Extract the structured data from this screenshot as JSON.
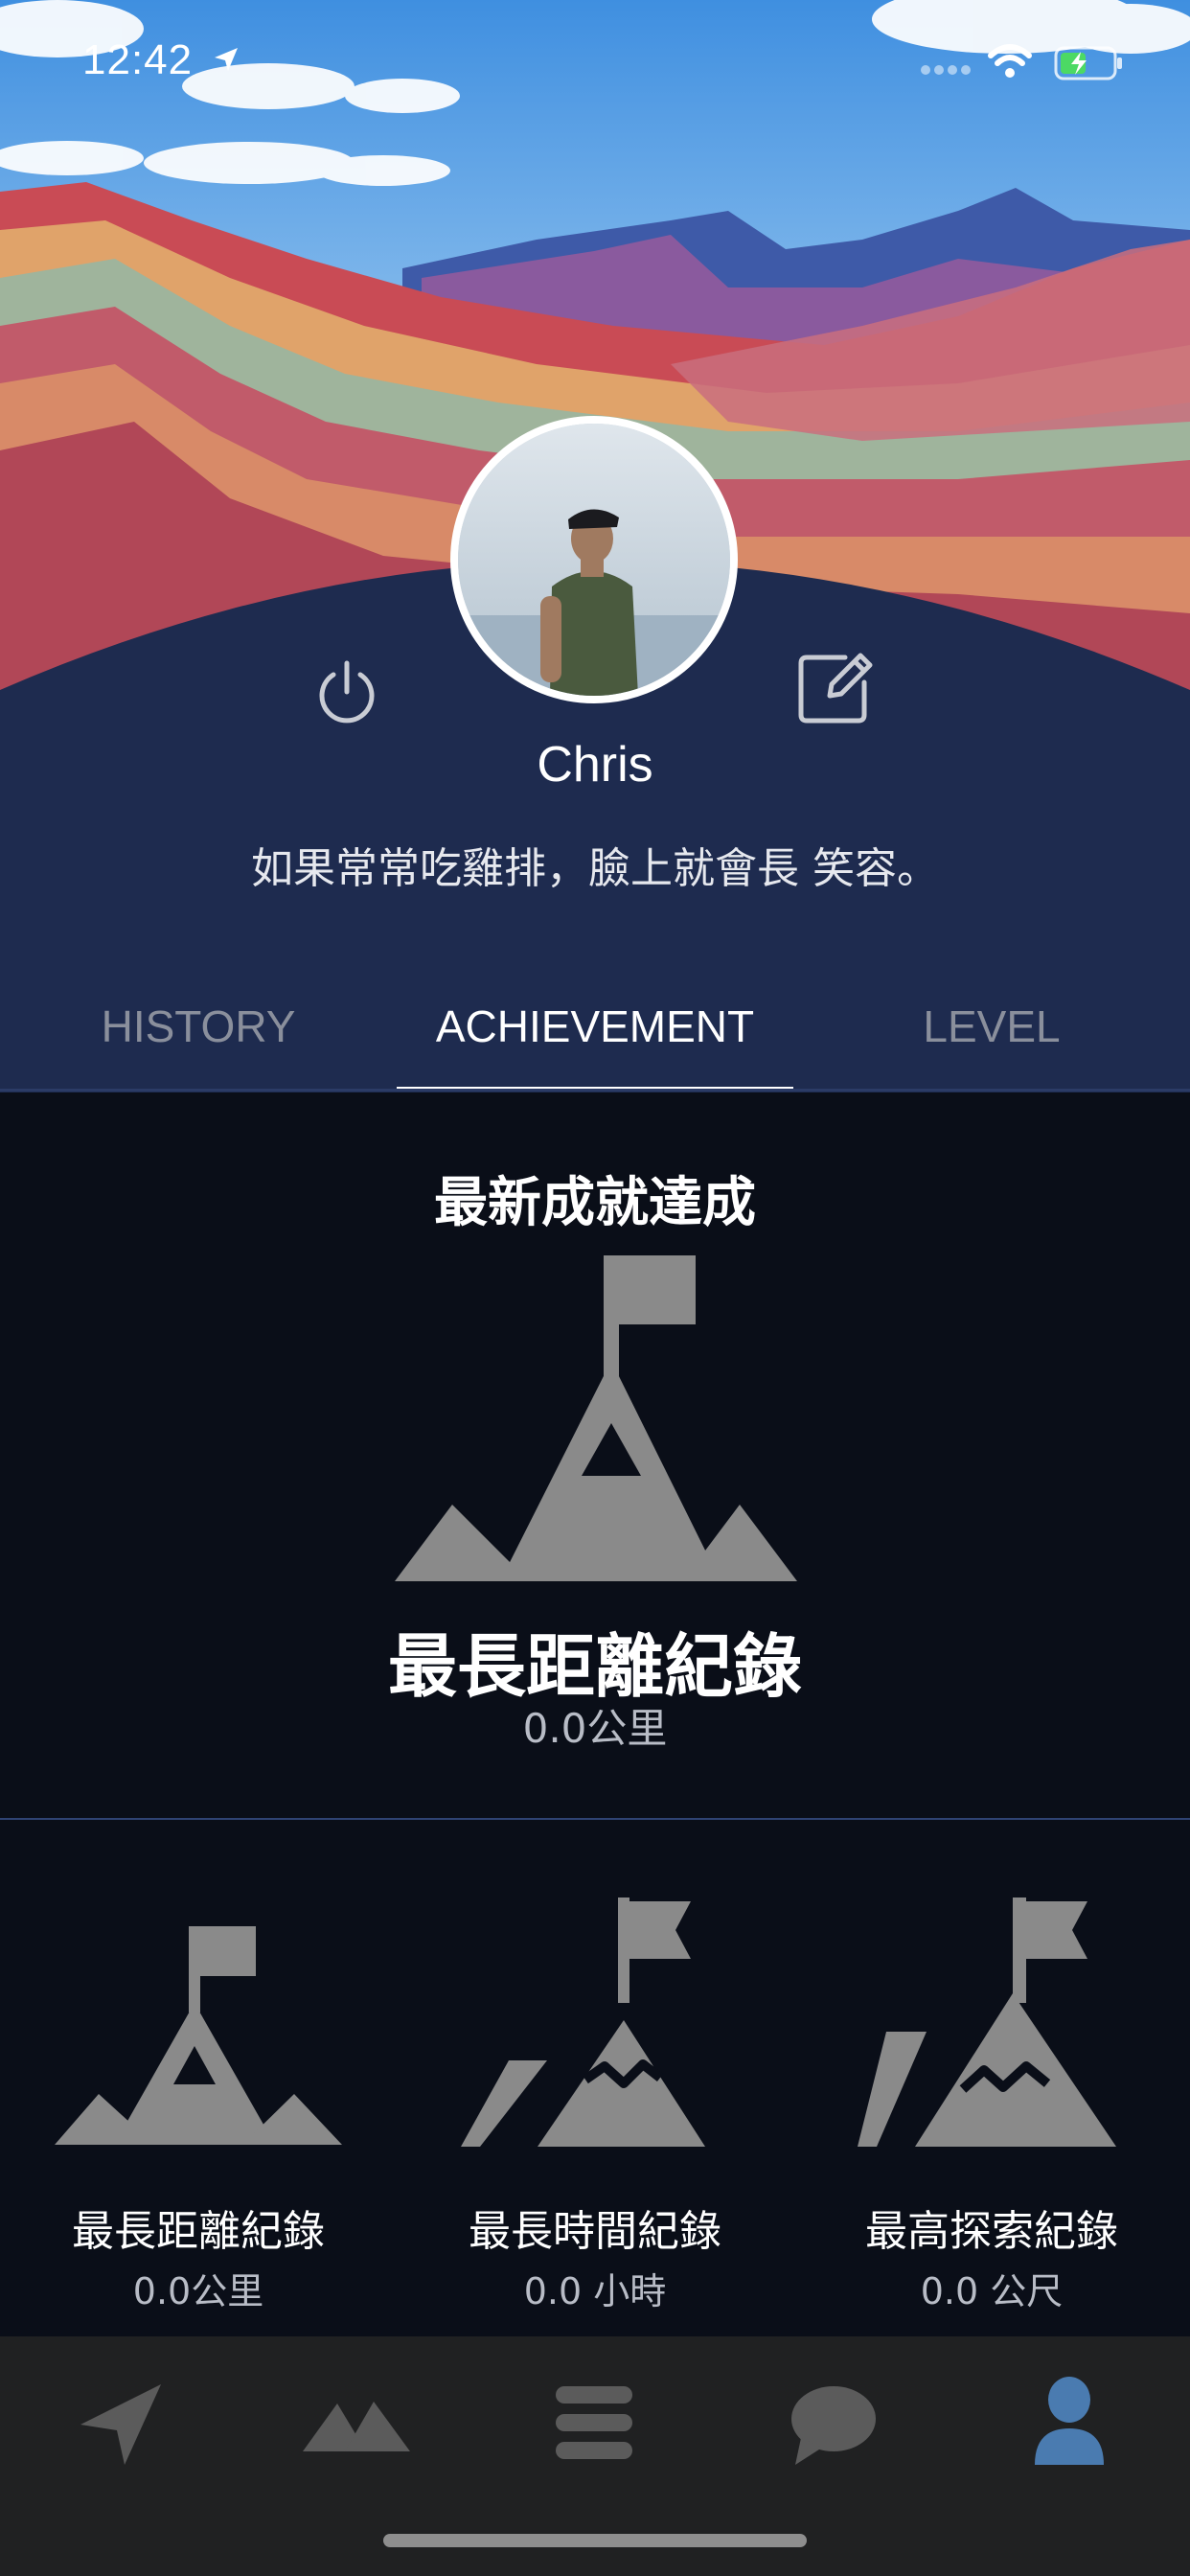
{
  "status_bar": {
    "time": "12:42"
  },
  "profile": {
    "name": "Chris",
    "bio": "如果常常吃雞排，臉上就會長 笑容。"
  },
  "tabs": [
    {
      "label": "HISTORY"
    },
    {
      "label": "ACHIEVEMENT"
    },
    {
      "label": "LEVEL"
    }
  ],
  "latest": {
    "title": "最新成就達成",
    "name": "最長距離紀錄",
    "value": "0.0公里"
  },
  "achievements": [
    {
      "name": "最長距離紀錄",
      "value": "0.0公里"
    },
    {
      "name": "最長時間紀錄",
      "value": "0.0 小時"
    },
    {
      "name": "最高探索紀錄",
      "value": "0.0 公尺"
    }
  ],
  "colors": {
    "panel": "#1e2b4f",
    "content_bg": "#0a0e18",
    "icon_gray": "#8a8a8a",
    "tabbar_bg": "#202122",
    "active_tab_icon": "#4a7bb0"
  }
}
